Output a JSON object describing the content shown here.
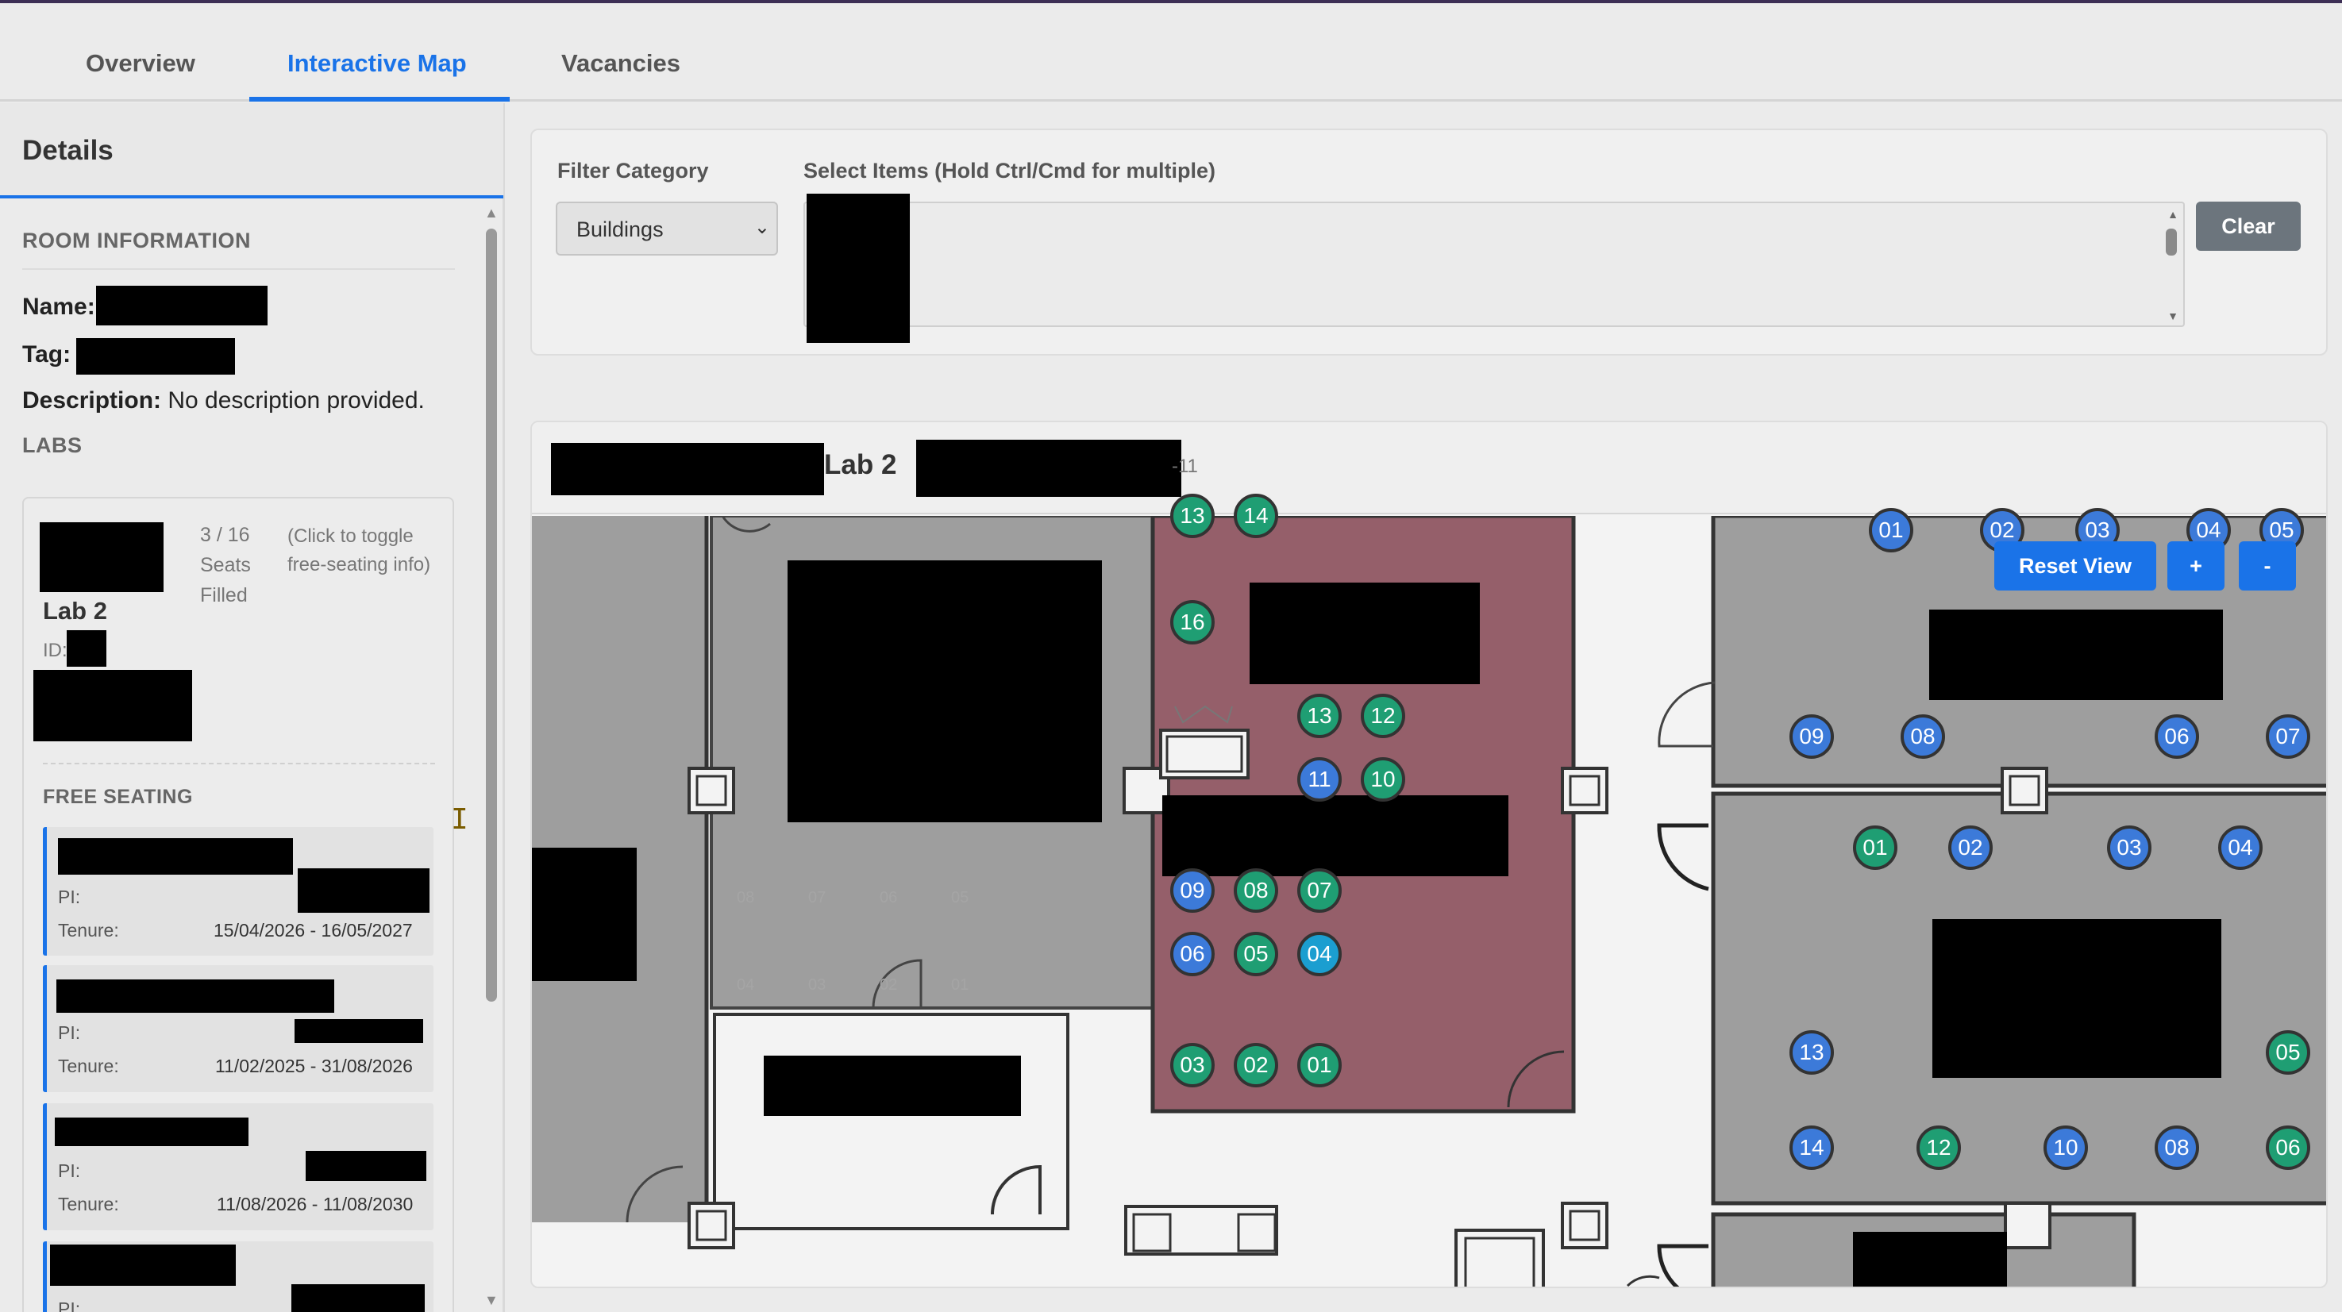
{
  "tabs": [
    {
      "label": "Overview"
    },
    {
      "label": "Interactive Map"
    },
    {
      "label": "Vacancies"
    }
  ],
  "sidebar": {
    "title": "Details",
    "room_info": {
      "heading": "ROOM INFORMATION",
      "name_label": "Name:",
      "tag_label": "Tag:",
      "description_label": "Description:",
      "description_value": "No description provided."
    },
    "labs_heading": "LABS",
    "lab": {
      "name": "Lab 2",
      "id_label": "ID:",
      "seats": "3 / 16",
      "seats_text_1": "Seats",
      "seats_text_2": "Filled",
      "toggle_hint_1": "(Click to toggle",
      "toggle_hint_2": "free-seating info)"
    },
    "free_seating": {
      "heading": "FREE SEATING",
      "items": [
        {
          "pi_label": "PI:",
          "tenure_label": "Tenure:",
          "tenure": "15/04/2026 - 16/05/2027"
        },
        {
          "pi_label": "PI:",
          "tenure_label": "Tenure:",
          "tenure": "11/02/2025 - 31/08/2026"
        },
        {
          "pi_label": "PI:",
          "tenure_label": "Tenure:",
          "tenure": "11/08/2026 - 11/08/2030"
        },
        {
          "pi_label": "PI:"
        }
      ]
    }
  },
  "filter": {
    "category_label": "Filter Category",
    "category_value": "Buildings",
    "items_label": "Select Items (Hold Ctrl/Cmd for multiple)",
    "clear_label": "Clear"
  },
  "map": {
    "title": "Lab 2",
    "subtitle_suffix": "-11",
    "reset_label": "Reset View",
    "zoom_in_label": "+",
    "zoom_out_label": "-",
    "seat_numbers": [
      "13",
      "14",
      "16",
      "13",
      "12",
      "11",
      "10",
      "09",
      "08",
      "07",
      "06",
      "05",
      "04",
      "03",
      "02",
      "01",
      "01",
      "02",
      "03",
      "04",
      "05",
      "09",
      "08",
      "06",
      "07",
      "01",
      "02",
      "03",
      "04",
      "13",
      "05",
      "14",
      "12",
      "10",
      "08",
      "06"
    ],
    "faint_labels": [
      "08",
      "07",
      "06",
      "05",
      "04",
      "03",
      "02",
      "01"
    ],
    "colors": {
      "seat_green": "#1f9e73",
      "seat_blue": "#3c7ad9",
      "seat_cyan": "#1b9ed0",
      "lab_highlight": "#955f6a",
      "accent": "#1a73e8"
    }
  }
}
